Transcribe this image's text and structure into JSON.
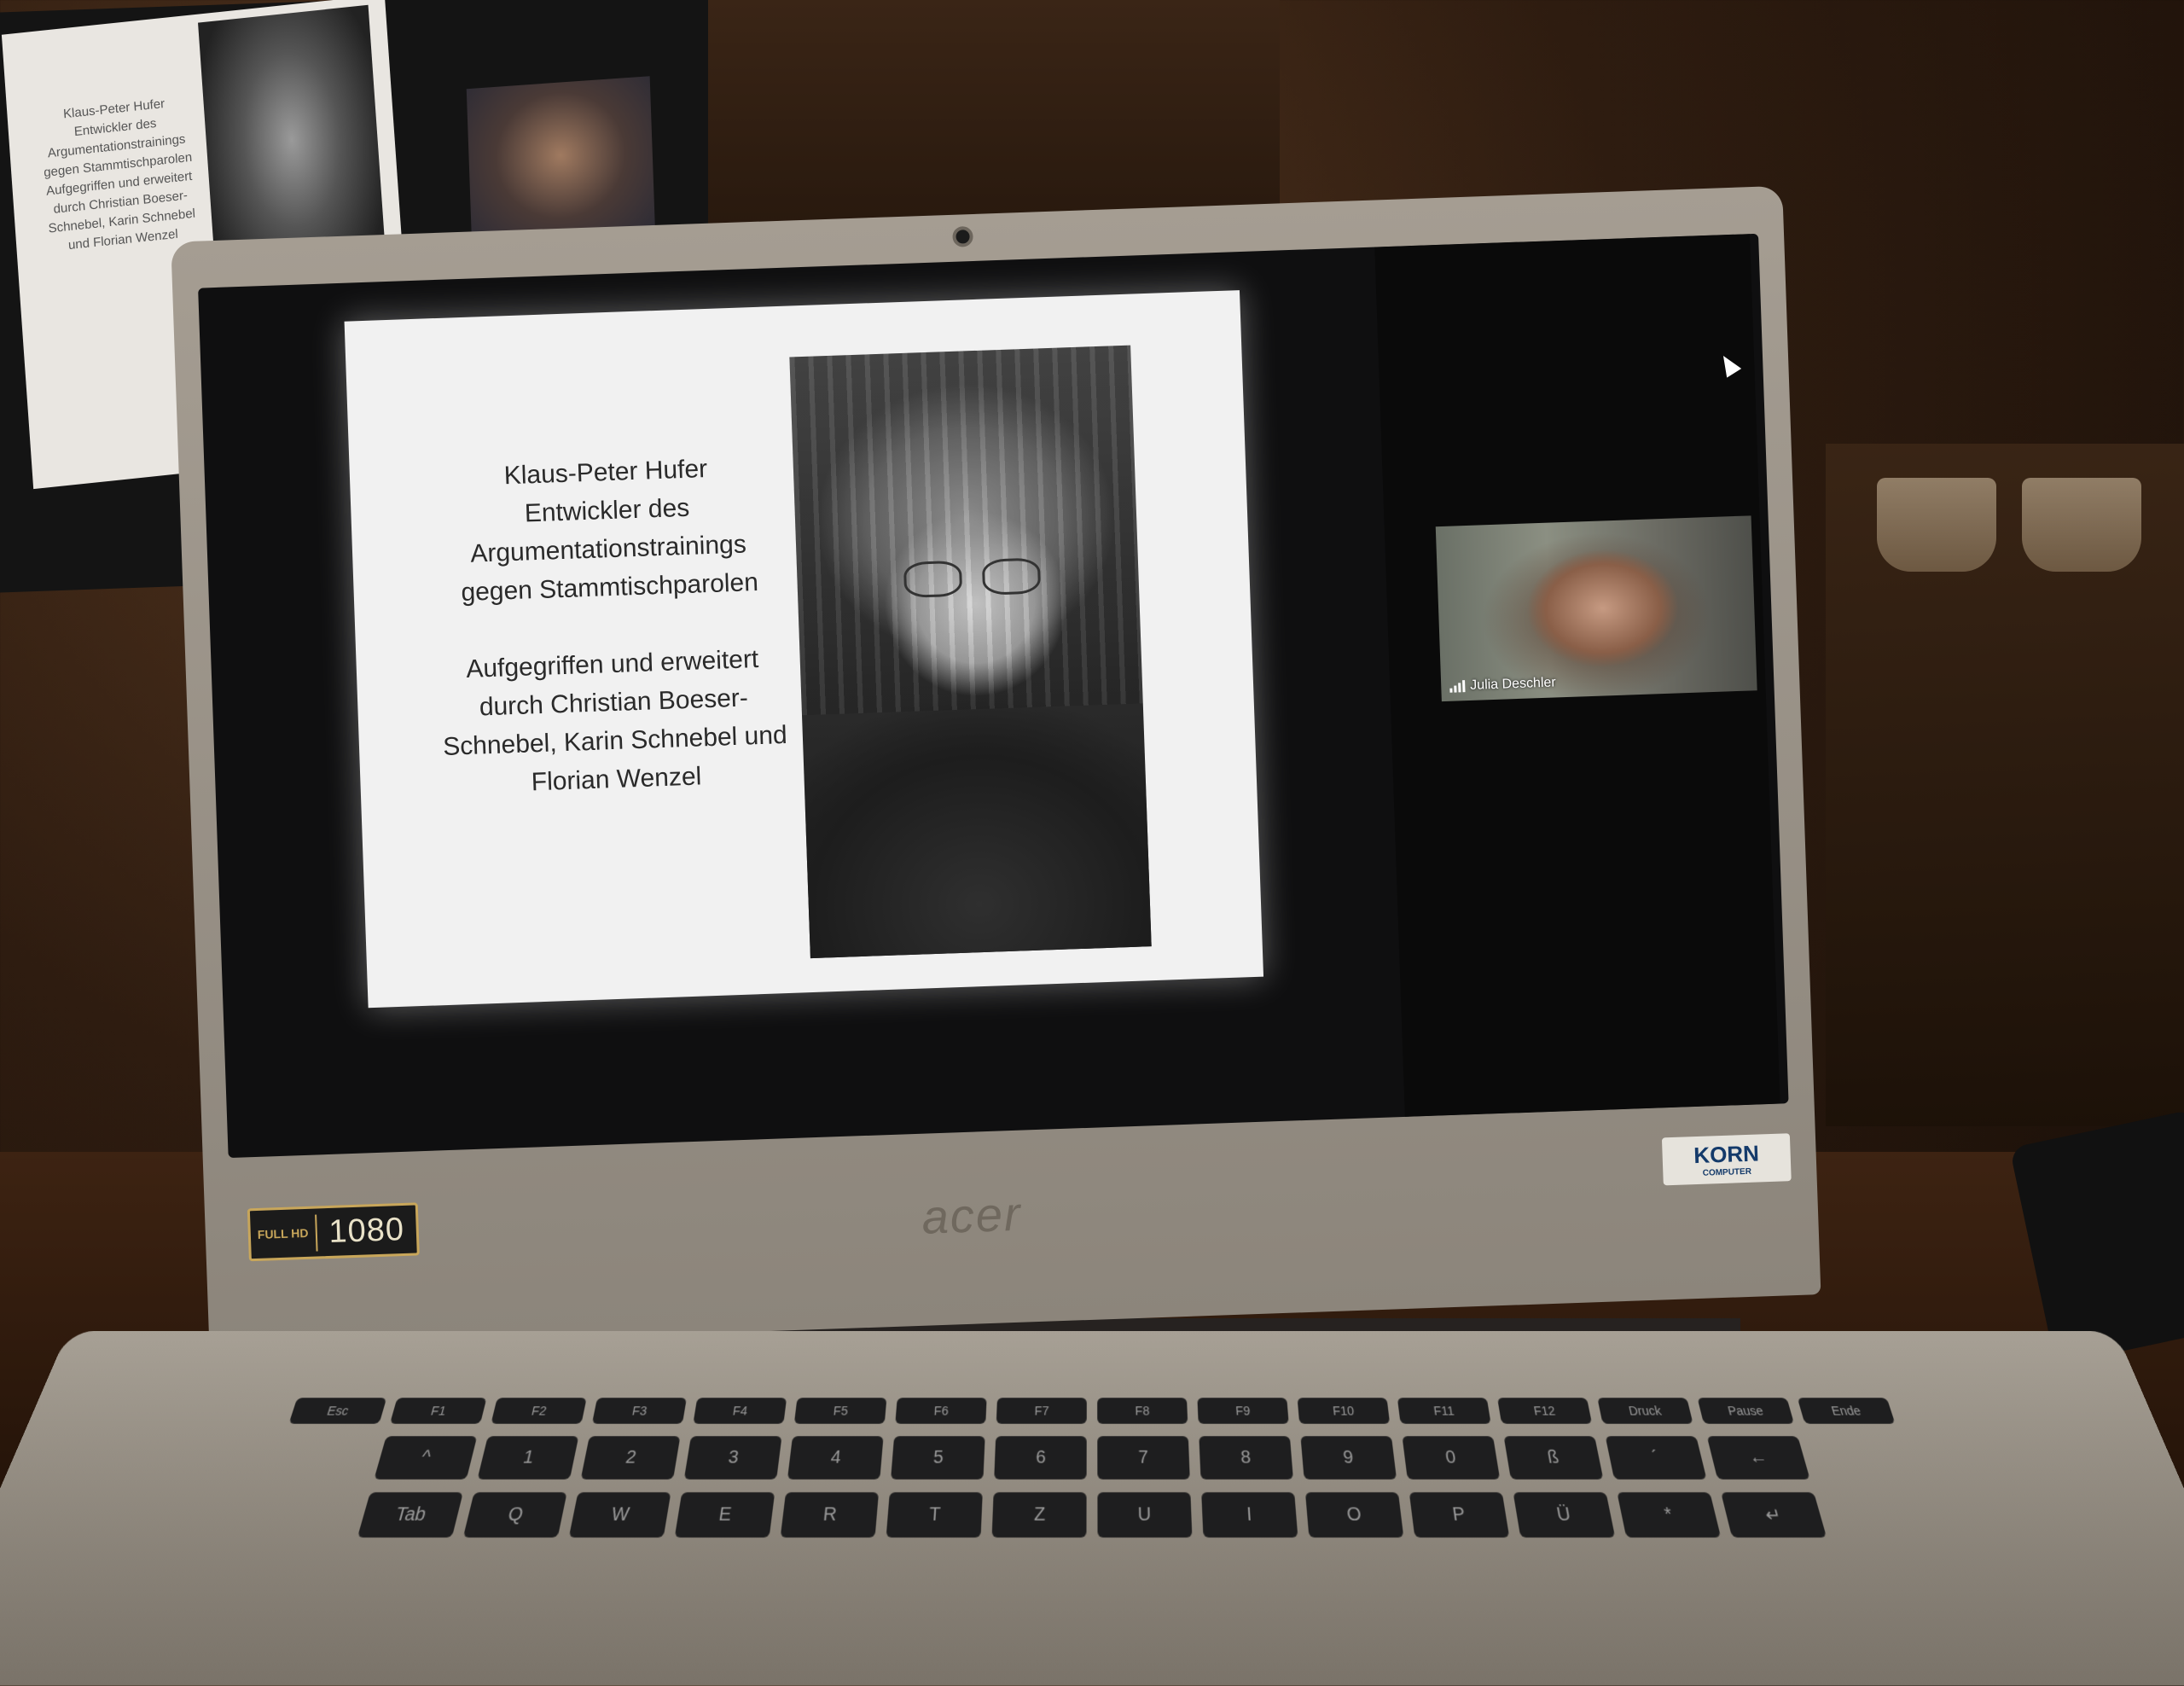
{
  "second_monitor": {
    "slide_text": "Klaus-Peter Hufer Entwickler des Argumentationstrainings gegen Stammtischparolen Aufgegriffen und erweitert durch Christian Boeser-Schnebel, Karin Schnebel und Florian Wenzel"
  },
  "slide": {
    "lines_block1": [
      "Klaus-Peter Hufer",
      "Entwickler des",
      "Argumentationstrainings",
      "gegen Stammtischparolen"
    ],
    "lines_block2": [
      "Aufgegriffen und erweitert",
      "durch Christian Boeser-",
      "Schnebel, Karin Schnebel und",
      "Florian Wenzel"
    ]
  },
  "participant": {
    "name": "Julia Deschler",
    "icon": "signal-bars-icon"
  },
  "bezel": {
    "fullhd_small": "FULL HD",
    "fullhd_big": "1080",
    "brand": "acer",
    "sticker": "KORN",
    "sticker_sub": "COMPUTER"
  },
  "keyboard": {
    "function_row": [
      "Esc",
      "F1",
      "F2",
      "F3",
      "F4",
      "F5",
      "F6",
      "F7",
      "F8",
      "F9",
      "F10",
      "F11",
      "F12",
      "Druck",
      "Pause",
      "Ende"
    ],
    "number_row": [
      "^",
      "1",
      "2",
      "3",
      "4",
      "5",
      "6",
      "7",
      "8",
      "9",
      "0",
      "ß",
      "´",
      "←"
    ],
    "top_row": [
      "Tab",
      "Q",
      "W",
      "E",
      "R",
      "T",
      "Z",
      "U",
      "I",
      "O",
      "P",
      "Ü",
      "*",
      "↵"
    ]
  }
}
